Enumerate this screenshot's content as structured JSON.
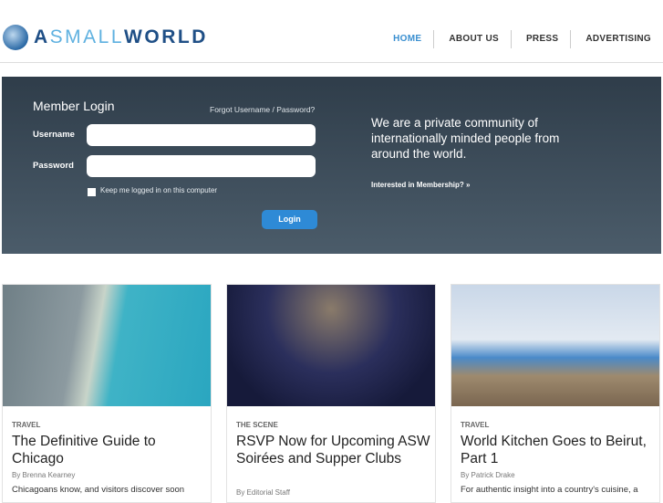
{
  "logo": {
    "part1": "A",
    "part2": "SMALL",
    "part3": "WORLD"
  },
  "nav": [
    "HOME",
    "ABOUT US",
    "PRESS",
    "ADVERTISING"
  ],
  "login": {
    "title": "Member Login",
    "forgot": "Forgot Username / Password?",
    "username_label": "Username",
    "password_label": "Password",
    "username_value": "",
    "password_value": "",
    "remember": "Keep me logged in on this computer",
    "button": "Login"
  },
  "promo": {
    "tagline": "We are a private community of internationally minded people from around the world.",
    "membership_link": "Interested in Membership? »"
  },
  "articles": [
    {
      "category": "TRAVEL",
      "title": "The Definitive Guide to Chicago",
      "author": "By Brenna Kearney",
      "excerpt": "Chicagoans know, and visitors discover soon"
    },
    {
      "category": "THE SCENE",
      "title": "RSVP Now for Upcoming ASW Soirées and Supper Clubs",
      "author": "By Editorial Staff",
      "excerpt": ""
    },
    {
      "category": "TRAVEL",
      "title": "World Kitchen Goes to Beirut, Part 1",
      "author": "By Patrick Drake",
      "excerpt": "For authentic insight into a country's cuisine, a"
    }
  ]
}
